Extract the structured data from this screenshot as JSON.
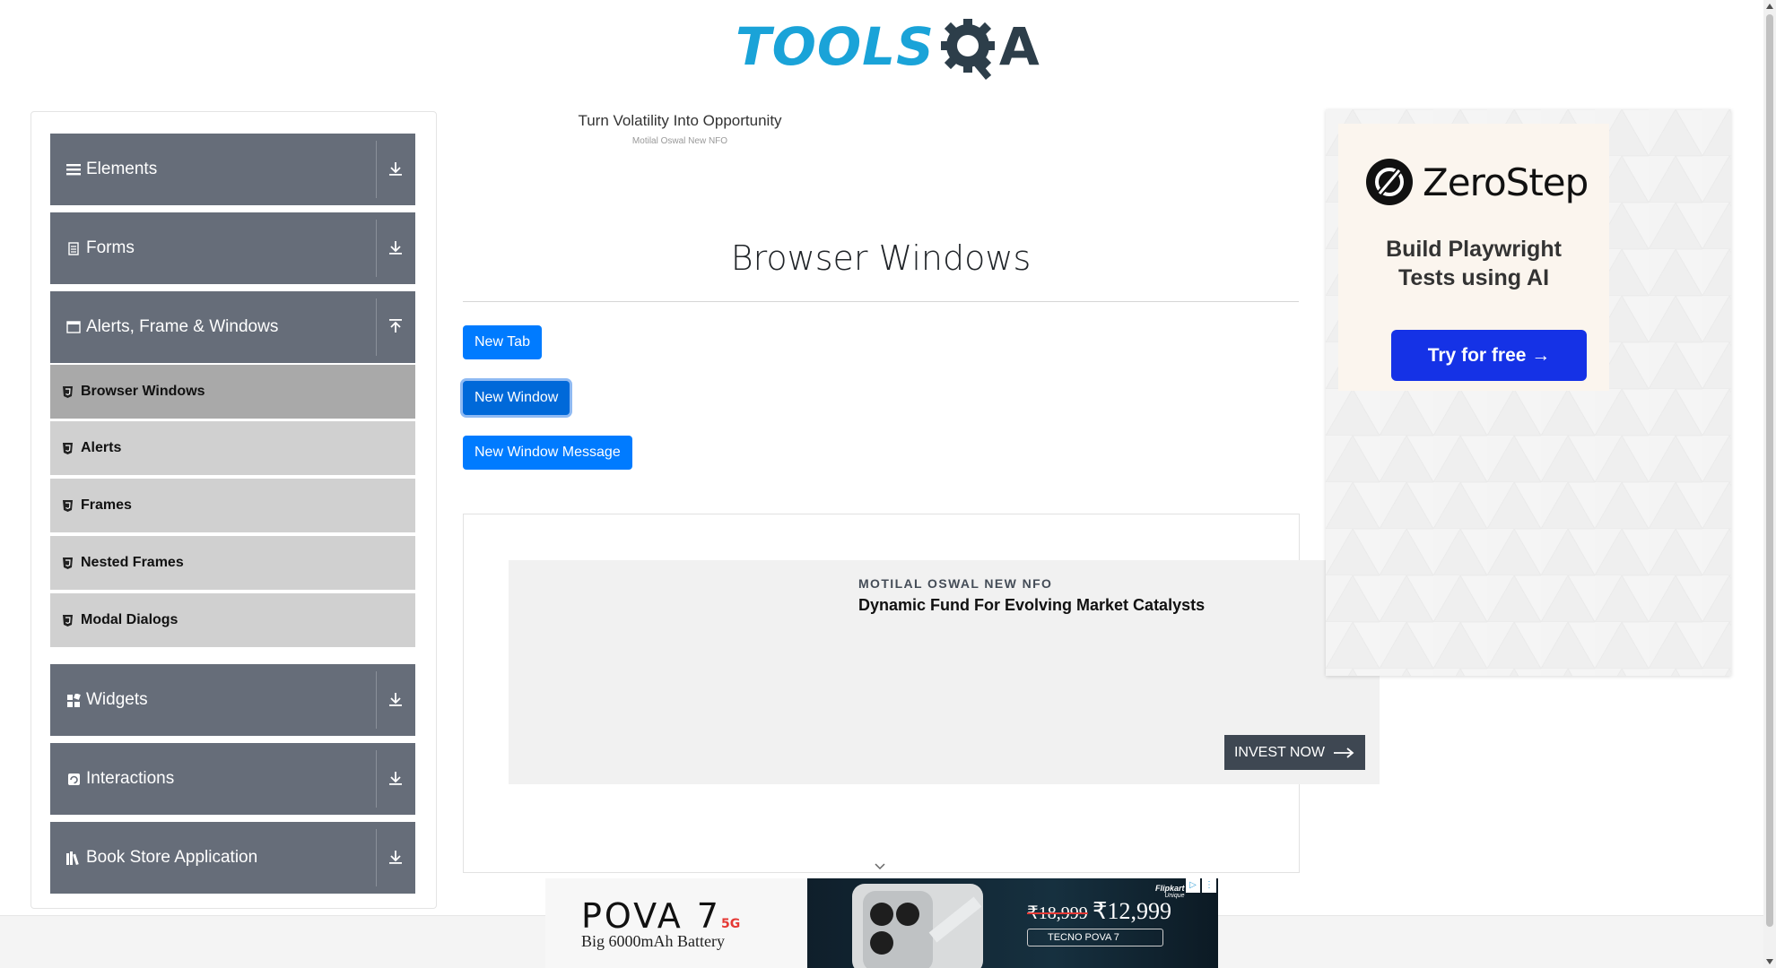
{
  "brand": {
    "tools": "TOOLS",
    "qa": "A"
  },
  "sidebar": {
    "groups": [
      {
        "label": "Elements",
        "icon": "hamburger-icon",
        "expanded": false
      },
      {
        "label": "Forms",
        "icon": "document-icon",
        "expanded": false
      },
      {
        "label": "Alerts, Frame & Windows",
        "icon": "window-icon",
        "expanded": true
      },
      {
        "label": "Widgets",
        "icon": "widgets-icon",
        "expanded": false
      },
      {
        "label": "Interactions",
        "icon": "interactions-icon",
        "expanded": false
      },
      {
        "label": "Book Store Application",
        "icon": "books-icon",
        "expanded": false
      }
    ],
    "submenu": [
      {
        "label": "Browser Windows",
        "active": true
      },
      {
        "label": "Alerts",
        "active": false
      },
      {
        "label": "Frames",
        "active": false
      },
      {
        "label": "Nested Frames",
        "active": false
      },
      {
        "label": "Modal Dialogs",
        "active": false
      }
    ]
  },
  "ad_top": {
    "title": "Turn Volatility Into Opportunity",
    "sub": "Motilal Oswal New NFO"
  },
  "main": {
    "title": "Browser Windows",
    "buttons": {
      "new_tab": "New Tab",
      "new_window": "New Window",
      "new_window_message": "New Window Message"
    }
  },
  "ad_mid": {
    "kicker": "MOTILAL OSWAL NEW NFO",
    "headline": "Dynamic Fund For Evolving Market Catalysts",
    "cta": "INVEST NOW"
  },
  "ad_right": {
    "brand": "ZeroStep",
    "tagline_1": "Build Playwright",
    "tagline_2": "Tests using AI",
    "cta": "Try for free →"
  },
  "ad_bottom": {
    "brand": "POVA 7",
    "badge": "5G",
    "battery": "Big 6000mAh Battery",
    "price_old": "₹18,999",
    "price_new": "₹12,999",
    "pill": "TECNO POVA 7",
    "flipkart": "Flipkart",
    "flipkart_sub": "Unique"
  },
  "colors": {
    "sidebar_group": "#666d79",
    "button": "#007bff",
    "logo_blue": "#1aa3d8",
    "zerostep_button": "#1532e6"
  }
}
